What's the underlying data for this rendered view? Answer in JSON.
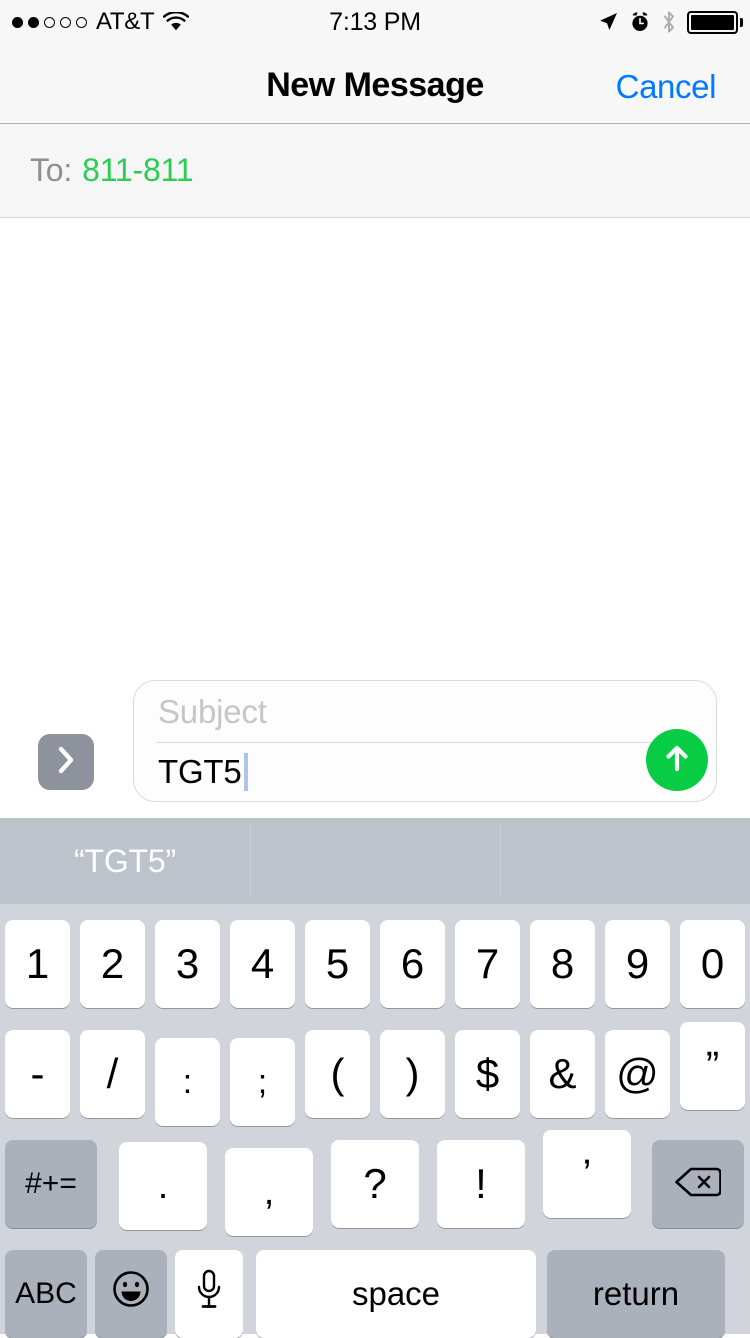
{
  "status_bar": {
    "signal_dots_total": 5,
    "signal_dots_filled": 2,
    "carrier": "AT&T",
    "wifi_icon": "wifi-icon",
    "time": "7:13 PM",
    "location_icon": "location-arrow-icon",
    "alarm_icon": "alarm-clock-icon",
    "bluetooth_icon": "bluetooth-icon",
    "battery_icon": "battery-full-icon"
  },
  "nav_bar": {
    "title": "New Message",
    "cancel_label": "Cancel",
    "cancel_color": "#007AFF"
  },
  "to_field": {
    "label": "To:",
    "recipient": "811-811",
    "recipient_color": "#2ACD52"
  },
  "compose": {
    "expand_icon": "chevron-right-icon",
    "subject_placeholder": "Subject",
    "subject_value": "",
    "body_value": "TGT5",
    "send_icon": "arrow-up-icon",
    "send_color": "#09CC45",
    "caret_color": "#AFC4E8"
  },
  "predictive_bar": {
    "suggestions": [
      "“TGT5”",
      "",
      ""
    ]
  },
  "keyboard": {
    "layout": "numbers-symbols",
    "row1": [
      "1",
      "2",
      "3",
      "4",
      "5",
      "6",
      "7",
      "8",
      "9",
      "0"
    ],
    "row2": [
      "-",
      "/",
      ":",
      ";",
      "(",
      ")",
      "$",
      "&",
      "@",
      "”"
    ],
    "row3": {
      "symbol_switch": "#+=",
      "punctuation": [
        ".",
        ",",
        "?",
        "!",
        "’"
      ],
      "delete_icon": "backspace-icon"
    },
    "row4": {
      "abc": "ABC",
      "emoji_icon": "emoji-smiley-icon",
      "dictation_icon": "microphone-icon",
      "space": "space",
      "return": "return"
    }
  }
}
